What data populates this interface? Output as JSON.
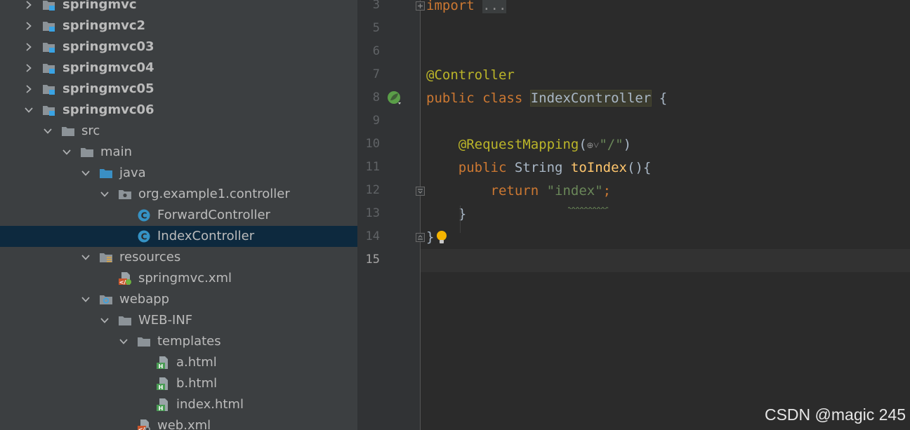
{
  "project_tree": {
    "items": [
      {
        "label": "springmvc",
        "level": 0,
        "expanded": false,
        "icon": "module-folder-icon",
        "bold": true
      },
      {
        "label": "springmvc2",
        "level": 0,
        "expanded": false,
        "icon": "module-folder-icon",
        "bold": true
      },
      {
        "label": "springmvc03",
        "level": 0,
        "expanded": false,
        "icon": "module-folder-icon",
        "bold": true
      },
      {
        "label": "springmvc04",
        "level": 0,
        "expanded": false,
        "icon": "module-folder-icon",
        "bold": true
      },
      {
        "label": "springmvc05",
        "level": 0,
        "expanded": false,
        "icon": "module-folder-icon",
        "bold": true
      },
      {
        "label": "springmvc06",
        "level": 0,
        "expanded": true,
        "icon": "module-folder-icon",
        "bold": true
      },
      {
        "label": "src",
        "level": 1,
        "expanded": true,
        "icon": "folder-icon"
      },
      {
        "label": "main",
        "level": 2,
        "expanded": true,
        "icon": "folder-icon"
      },
      {
        "label": "java",
        "level": 3,
        "expanded": true,
        "icon": "source-root-folder-icon"
      },
      {
        "label": "org.example1.controller",
        "level": 4,
        "expanded": true,
        "icon": "package-icon"
      },
      {
        "label": "ForwardController",
        "level": 5,
        "icon": "java-class-icon"
      },
      {
        "label": "IndexController",
        "level": 5,
        "icon": "java-class-icon",
        "selected": true
      },
      {
        "label": "resources",
        "level": 3,
        "expanded": true,
        "icon": "resources-folder-icon"
      },
      {
        "label": "springmvc.xml",
        "level": 4,
        "icon": "spring-xml-icon"
      },
      {
        "label": "webapp",
        "level": 3,
        "expanded": true,
        "icon": "web-folder-icon"
      },
      {
        "label": "WEB-INF",
        "level": 4,
        "expanded": true,
        "icon": "folder-icon"
      },
      {
        "label": "templates",
        "level": 5,
        "expanded": true,
        "icon": "folder-icon"
      },
      {
        "label": "a.html",
        "level": 6,
        "icon": "html-file-icon"
      },
      {
        "label": "b.html",
        "level": 6,
        "icon": "html-file-icon"
      },
      {
        "label": "index.html",
        "level": 6,
        "icon": "html-file-icon"
      },
      {
        "label": "web.xml",
        "level": 5,
        "icon": "web-xml-icon"
      }
    ]
  },
  "editor": {
    "current_line": "15",
    "lines": [
      {
        "num": "3",
        "tokens": [
          {
            "t": "import",
            "c": "k"
          },
          {
            "t": " "
          },
          {
            "t": "...",
            "c": "fold"
          }
        ]
      },
      {
        "num": "5",
        "tokens": []
      },
      {
        "num": "6",
        "tokens": []
      },
      {
        "num": "7",
        "tokens": [
          {
            "t": "@Controller",
            "c": "a"
          }
        ]
      },
      {
        "num": "8",
        "tokens": [
          {
            "t": "public class ",
            "c": "k"
          },
          {
            "t": "IndexController",
            "c": "cls"
          },
          {
            "t": " {"
          }
        ]
      },
      {
        "num": "9",
        "tokens": []
      },
      {
        "num": "10",
        "tokens": [
          {
            "t": "    "
          },
          {
            "t": "@RequestMapping",
            "c": "a"
          },
          {
            "t": "("
          },
          {
            "t": "⊕˅",
            "c": "globe"
          },
          {
            "t": "\"/\"",
            "c": "s"
          },
          {
            "t": ")"
          }
        ]
      },
      {
        "num": "11",
        "tokens": [
          {
            "t": "    "
          },
          {
            "t": "public ",
            "c": "k"
          },
          {
            "t": "String "
          },
          {
            "t": "toIndex",
            "c": "f"
          },
          {
            "t": "(){"
          }
        ]
      },
      {
        "num": "12",
        "tokens": [
          {
            "t": "        "
          },
          {
            "t": "return ",
            "c": "k"
          },
          {
            "t": "\"index\"",
            "c": "s"
          },
          {
            "t": ";",
            "c": "k"
          }
        ]
      },
      {
        "num": "13",
        "tokens": [
          {
            "t": "    }"
          }
        ]
      },
      {
        "num": "14",
        "tokens": [
          {
            "t": "}"
          }
        ]
      },
      {
        "num": "15",
        "tokens": []
      }
    ]
  },
  "watermark": "CSDN @magic 245",
  "colors": {
    "tree_bg": "#3c3f41",
    "selection": "#0d293e",
    "editor_bg": "#2b2b2b",
    "keyword": "#cc7832",
    "annotation": "#bbb529",
    "string": "#6a8759",
    "method": "#ffc66d"
  }
}
